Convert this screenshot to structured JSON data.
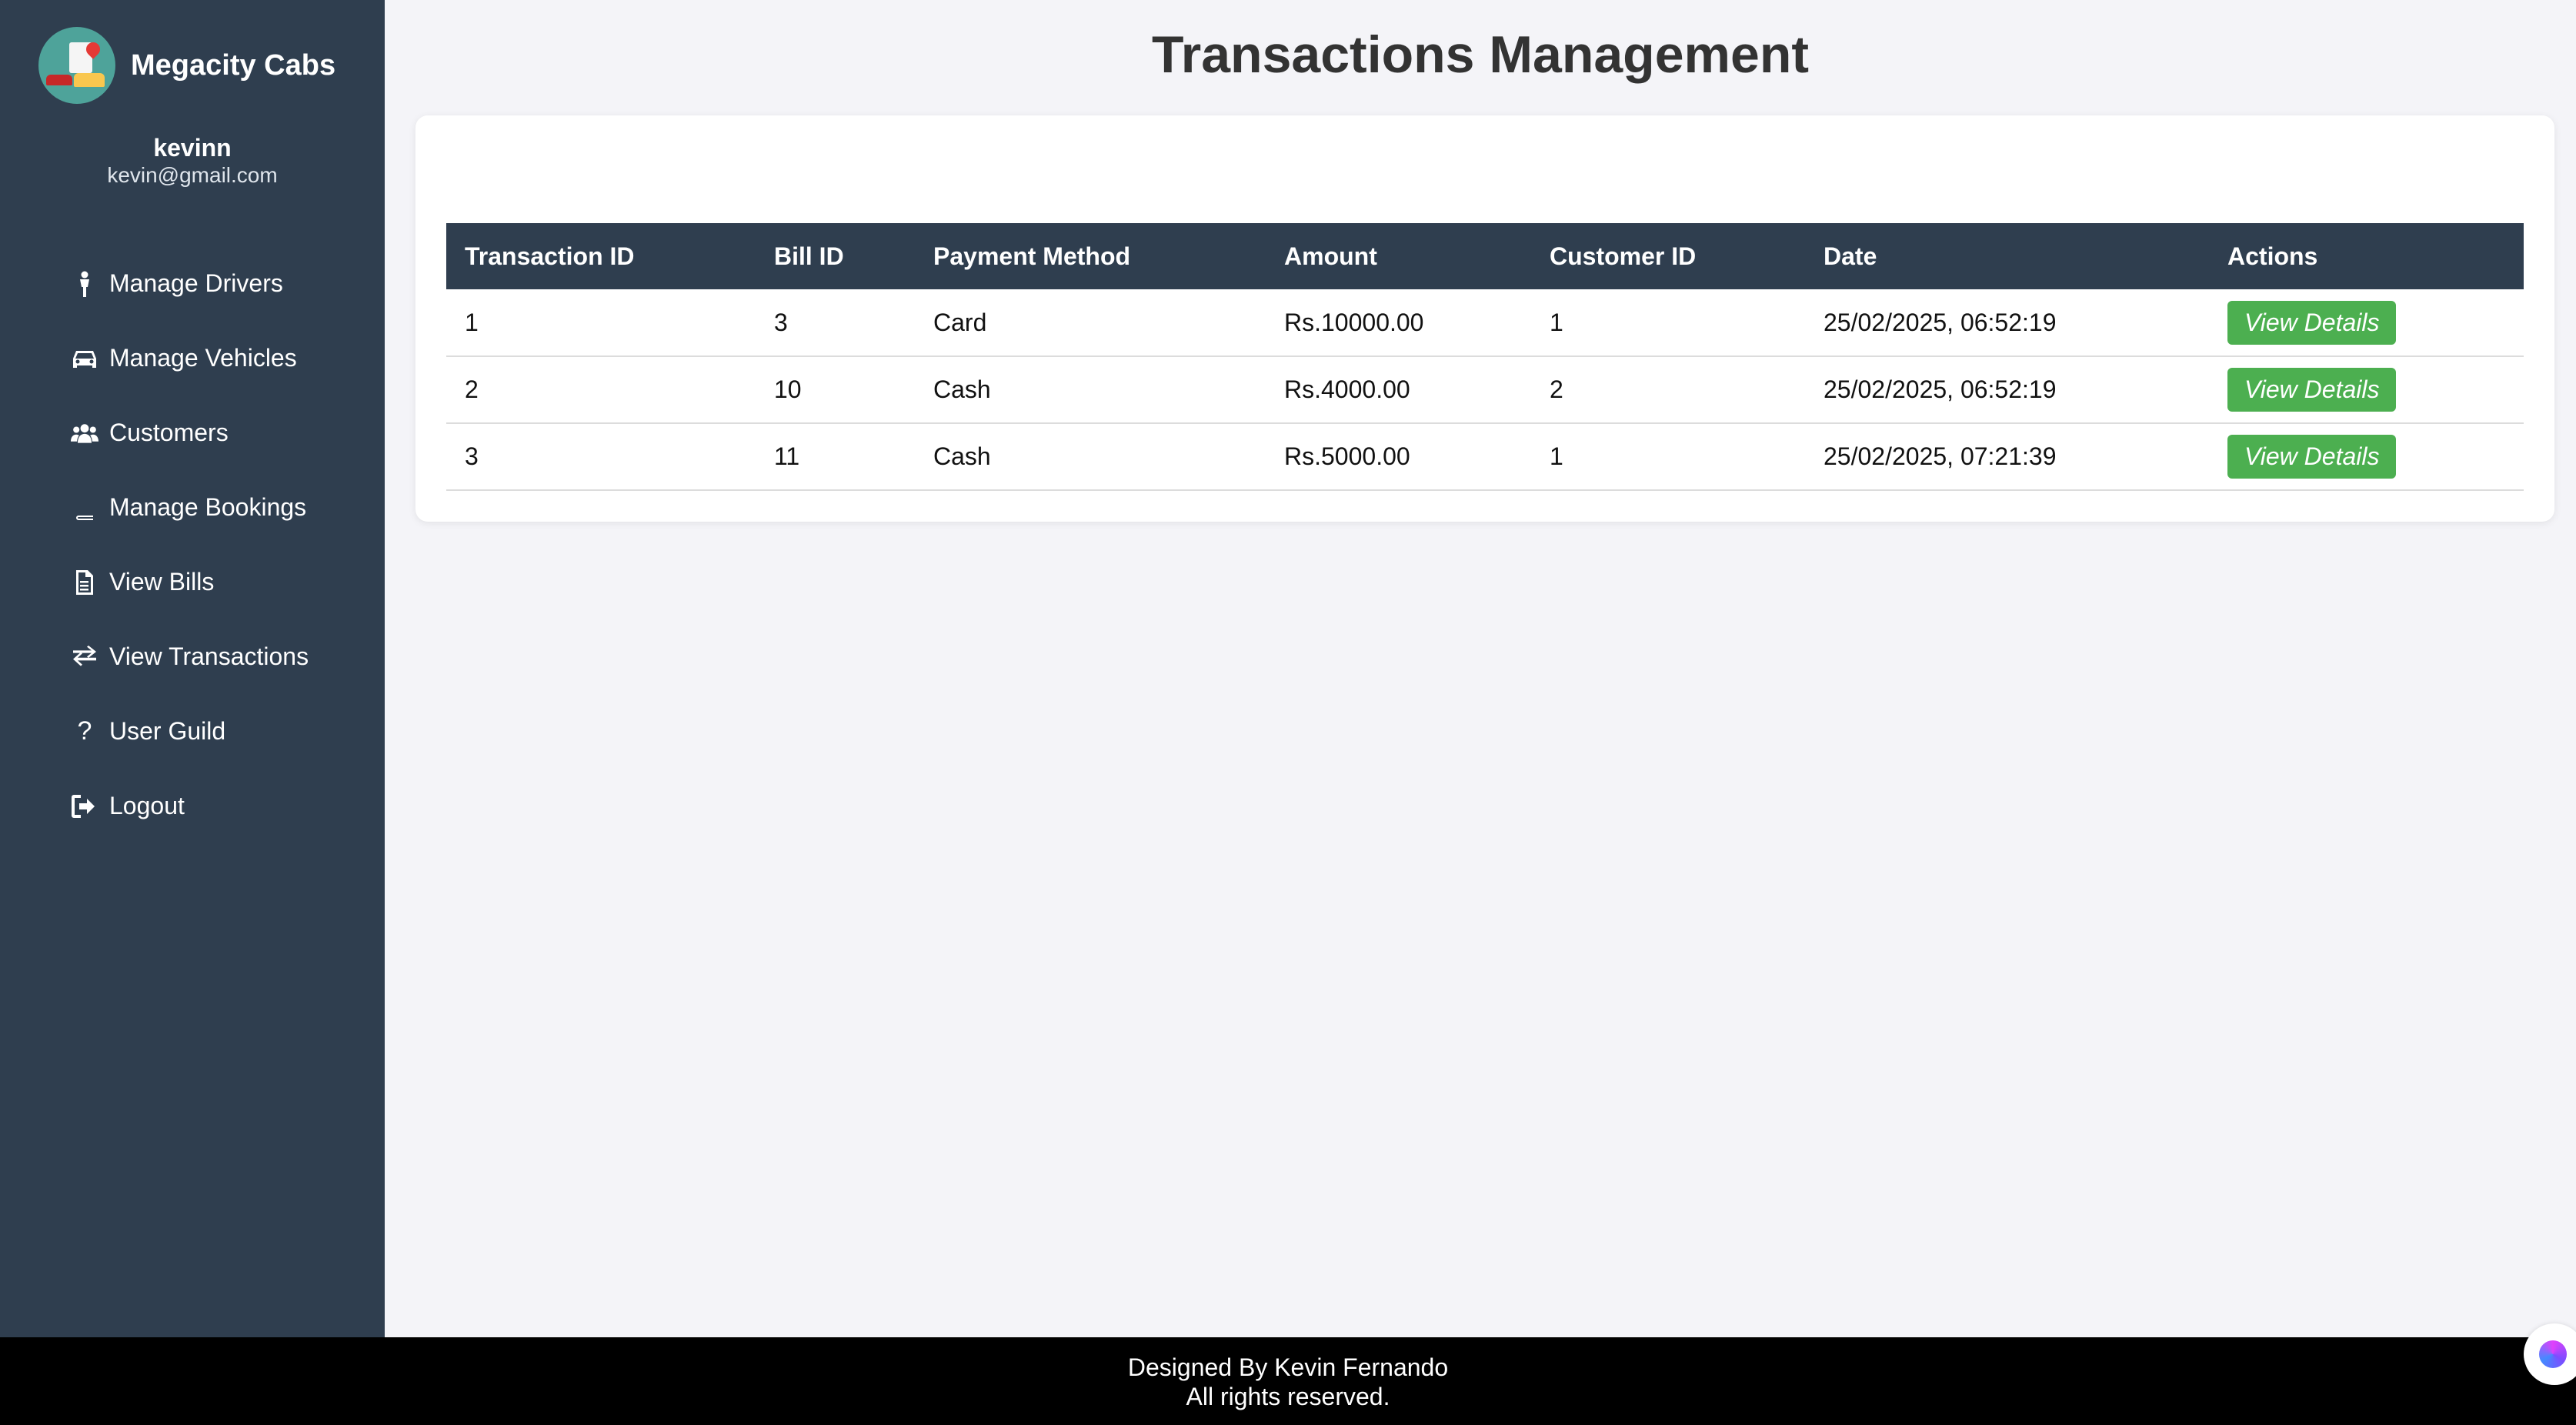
{
  "brand": {
    "name": "Megacity Cabs"
  },
  "user": {
    "name": "kevinn",
    "email": "kevin@gmail.com"
  },
  "nav": [
    {
      "label": "Manage Drivers",
      "icon": "person-icon"
    },
    {
      "label": "Manage Vehicles",
      "icon": "car-icon"
    },
    {
      "label": "Customers",
      "icon": "users-icon"
    },
    {
      "label": "Manage Bookings",
      "icon": "book-icon"
    },
    {
      "label": "View Bills",
      "icon": "file-icon"
    },
    {
      "label": "View Transactions",
      "icon": "exchange-icon"
    },
    {
      "label": "User Guild",
      "icon": "question-icon"
    },
    {
      "label": "Logout",
      "icon": "logout-icon"
    }
  ],
  "page": {
    "title": "Transactions Management"
  },
  "table": {
    "headers": [
      "Transaction ID",
      "Bill ID",
      "Payment Method",
      "Amount",
      "Customer ID",
      "Date",
      "Actions"
    ],
    "rows": [
      {
        "transaction_id": "1",
        "bill_id": "3",
        "payment_method": "Card",
        "amount": "Rs.10000.00",
        "customer_id": "1",
        "date": "25/02/2025, 06:52:19",
        "action": "View Details"
      },
      {
        "transaction_id": "2",
        "bill_id": "10",
        "payment_method": "Cash",
        "amount": "Rs.4000.00",
        "customer_id": "2",
        "date": "25/02/2025, 06:52:19",
        "action": "View Details"
      },
      {
        "transaction_id": "3",
        "bill_id": "11",
        "payment_method": "Cash",
        "amount": "Rs.5000.00",
        "customer_id": "1",
        "date": "25/02/2025, 07:21:39",
        "action": "View Details"
      }
    ]
  },
  "footer": {
    "line1": "Designed By Kevin Fernando",
    "line2": "All rights reserved."
  },
  "colors": {
    "sidebar": "#2f3e4f",
    "table_header": "#2f3e4f",
    "button": "#4caf50",
    "footer": "#000000"
  }
}
